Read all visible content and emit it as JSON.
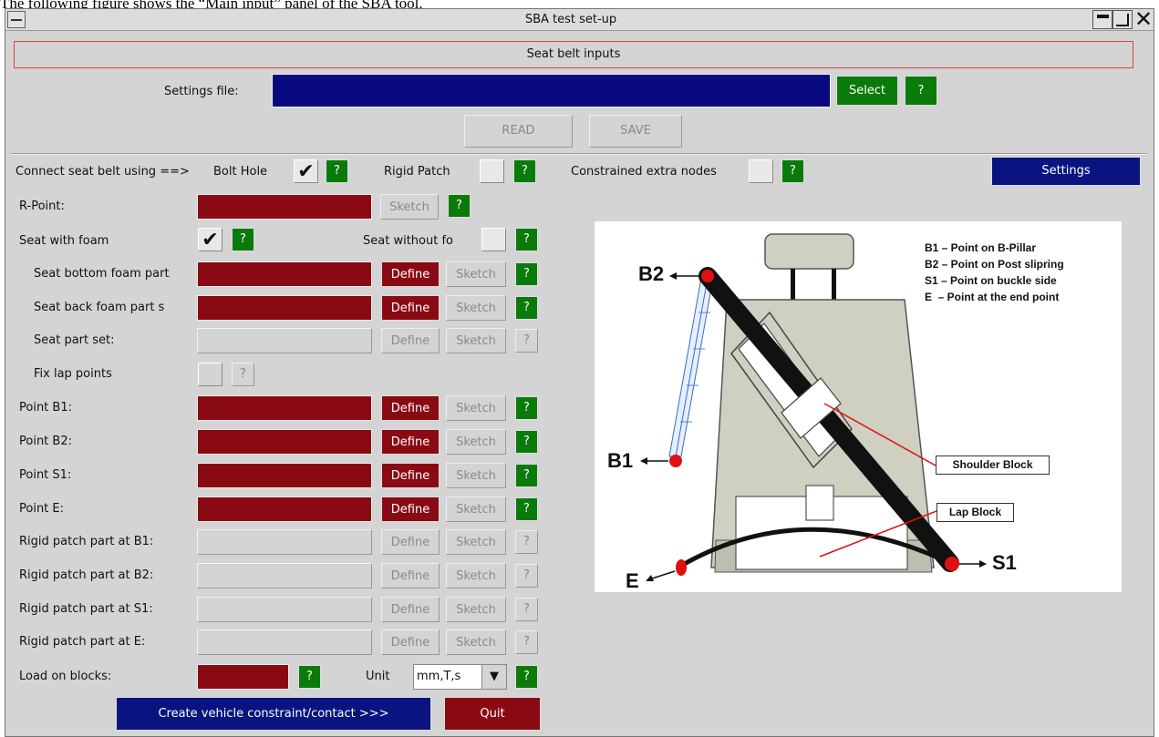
{
  "caption": "The following figure shows the “Main input” panel of the SBA tool.",
  "window": {
    "title": "SBA test set-up"
  },
  "section": {
    "title": "Seat belt inputs"
  },
  "settings_file": {
    "label": "Settings file:",
    "value": "",
    "select_label": "Select",
    "help": "?"
  },
  "io": {
    "read": "READ",
    "save": "SAVE"
  },
  "connect": {
    "label": "Connect seat belt using ==>",
    "bolt_hole": "Bolt Hole",
    "bolt_hole_checked": "✔",
    "rigid_patch": "Rigid Patch",
    "constrained": "Constrained extra nodes",
    "settings": "Settings",
    "help": "?"
  },
  "rpoint": {
    "label": "R-Point:",
    "sketch": "Sketch",
    "help": "?"
  },
  "seat": {
    "with_foam": "Seat with foam",
    "with_foam_checked": "✔",
    "without_foam": "Seat without fo",
    "help": "?"
  },
  "rows": [
    {
      "label": "Seat bottom foam part",
      "define": "Define",
      "sketch": "Sketch",
      "help": "?"
    },
    {
      "label": "Seat back foam part s",
      "define": "Define",
      "sketch": "Sketch",
      "help": "?"
    },
    {
      "label": "Seat part set:",
      "define": "Define",
      "sketch": "Sketch",
      "help": "?"
    },
    {
      "label": "Fix lap points",
      "help": "?"
    },
    {
      "label": "Point B1:",
      "define": "Define",
      "sketch": "Sketch",
      "help": "?"
    },
    {
      "label": "Point B2:",
      "define": "Define",
      "sketch": "Sketch",
      "help": "?"
    },
    {
      "label": "Point S1:",
      "define": "Define",
      "sketch": "Sketch",
      "help": "?"
    },
    {
      "label": "Point E:",
      "define": "Define",
      "sketch": "Sketch",
      "help": "?"
    },
    {
      "label": "Rigid patch part at B1:",
      "define": "Define",
      "sketch": "Sketch",
      "help": "?"
    },
    {
      "label": "Rigid patch part at B2:",
      "define": "Define",
      "sketch": "Sketch",
      "help": "?"
    },
    {
      "label": "Rigid patch part at S1:",
      "define": "Define",
      "sketch": "Sketch",
      "help": "?"
    },
    {
      "label": "Rigid patch part at E:",
      "define": "Define",
      "sketch": "Sketch",
      "help": "?"
    }
  ],
  "load": {
    "label": "Load on blocks:",
    "help": "?",
    "unit_label": "Unit",
    "unit_value": "mm,T,s"
  },
  "actions": {
    "create": "Create vehicle constraint/contact >>>",
    "quit": "Quit"
  },
  "diagram": {
    "legend": [
      "B1 – Point on B-Pillar",
      "B2 – Point on Post slipring",
      "S1 – Point on buckle side",
      "E  – Point at the end point"
    ],
    "labels": {
      "b1": "B1",
      "b2": "B2",
      "s1": "S1",
      "e": "E"
    },
    "shoulder_block": "Shoulder Block",
    "lap_block": "Lap Block"
  },
  "colors": {
    "field_red": "#8a0a14",
    "field_blue": "#0a0a80",
    "help_green": "#0a7a0a",
    "button_blue": "#0a1480"
  }
}
